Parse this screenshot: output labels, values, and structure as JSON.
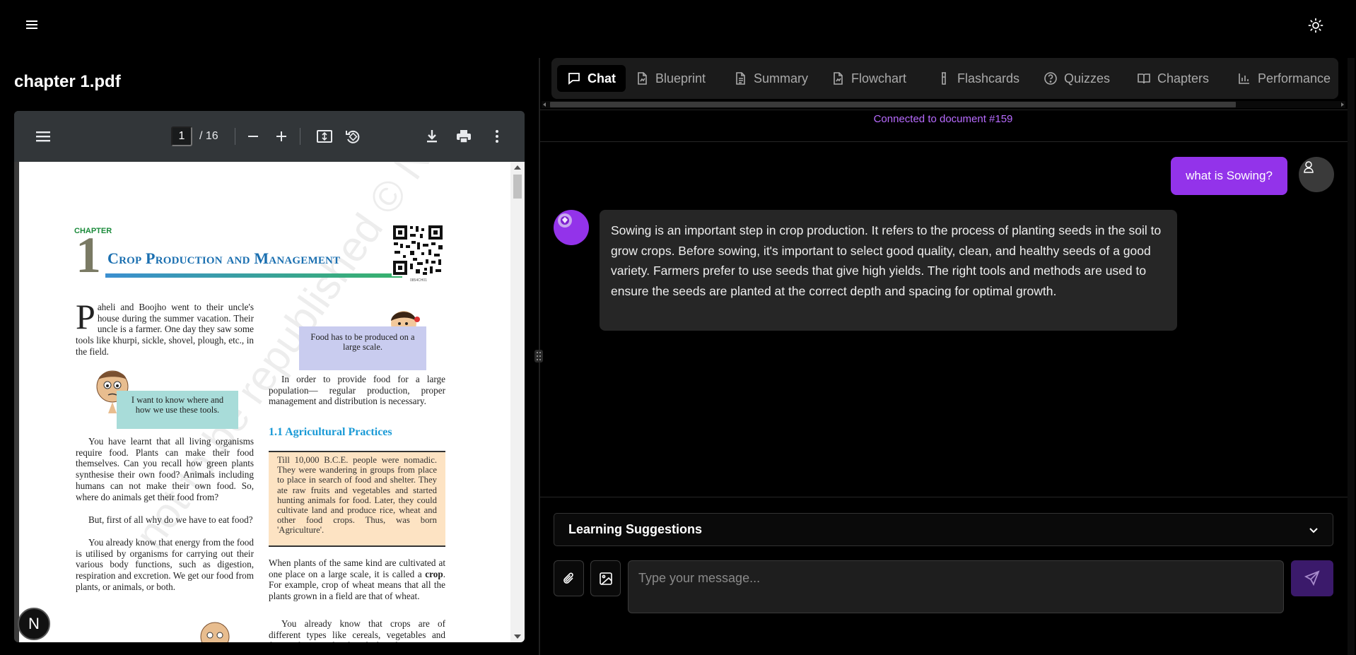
{
  "app": {
    "menu_icon": "hamburger-menu-icon",
    "theme_icon": "sun-icon"
  },
  "document": {
    "title": "chapter 1.pdf"
  },
  "viewer": {
    "page_current": "1",
    "page_total": "/ 16",
    "icons": [
      "sidebar-menu-icon",
      "zoom-out-icon",
      "zoom-in-icon",
      "fit-page-icon",
      "rotate-icon",
      "download-icon",
      "print-icon",
      "more-options-icon"
    ],
    "page": {
      "chapter_label": "CHAPTER",
      "chapter_number": "1",
      "chapter_title": "Crop Production and Management",
      "qr_code_id": "0854CH01",
      "intro_paragraph": "aheli and Boojho went to their uncle's house during the summer vacation. Their uncle is a farmer. One day they saw some tools like khurpi, sickle, shovel, plough, etc., in the field.",
      "intro_dropcap": "P",
      "callout_food": "Food has to be produced on a large scale.",
      "callout_tools": "I want to know where and how we use these tools.",
      "right_paragraph_1": "In order to provide food for a large population— regular production, proper management and distribution is necessary.",
      "section_heading": "1.1 Agricultural Practices",
      "history_box": "Till 10,000 B.C.E. people were nomadic. They were wandering in groups from place to place in search of food and shelter. They ate raw fruits and vegetables and started hunting animals for food. Later, they could cultivate land and produce rice, wheat and other food crops. Thus, was born 'Agriculture'.",
      "left_paragraph_2": "You have learnt that all living organisms require food. Plants can make their food themselves. Can you recall how green plants synthesise their own food? Animals including humans can not make their own food. So, where do animals get their food from?",
      "left_paragraph_3": "But, first of all why do we have to eat food?",
      "left_paragraph_4": "You already know that energy from the food is utilised by organisms for carrying out their various body functions, such as digestion, respiration and excretion. We get our food from plants, or animals, or both.",
      "right_paragraph_2_a": "When plants of the same kind are cultivated at one place on a large scale, it is called a ",
      "right_paragraph_2_bold": "crop",
      "right_paragraph_2_b": ". For example, crop of wheat means that all the plants grown in a field are that of wheat.",
      "right_paragraph_3": "You already know that crops are of different types like cereals, vegetables and fruits. These can be classified on the",
      "watermark": "not to be republished © NCERT"
    }
  },
  "floating_badge": "N",
  "tabs": [
    {
      "label": "Chat",
      "icon": "chat-bubble-icon",
      "active": true
    },
    {
      "label": "Blueprint",
      "icon": "document-chart-icon",
      "active": false
    },
    {
      "label": "Summary",
      "icon": "document-text-icon",
      "active": false
    },
    {
      "label": "Flowchart",
      "icon": "document-flow-icon",
      "active": false
    },
    {
      "label": "Flashcards",
      "icon": "flask-icon",
      "active": false
    },
    {
      "label": "Quizzes",
      "icon": "help-circle-icon",
      "active": false
    },
    {
      "label": "Chapters",
      "icon": "book-open-icon",
      "active": false
    },
    {
      "label": "Performance",
      "icon": "bar-chart-icon",
      "active": false
    }
  ],
  "chat": {
    "status": "Connected to document #159",
    "messages": [
      {
        "role": "user",
        "text": "what is Sowing?"
      },
      {
        "role": "assistant",
        "text": "Sowing is an important step in crop production. It refers to the process of planting seeds in the soil to grow crops. Before sowing, it's important to select good quality, clean, and healthy seeds of a good variety. Farmers prefer to use seeds that give high yields. The right tools and methods are used to ensure the seeds are planted at the correct depth and spacing for optimal growth."
      }
    ],
    "suggestions_label": "Learning Suggestions",
    "input_placeholder": "Type your message...",
    "attach_icon": "paperclip-icon",
    "image_icon": "image-icon",
    "send_icon": "send-icon"
  },
  "colors": {
    "accent": "#9333ea",
    "status_text": "#b86bff",
    "send_button": "#3b1a6b"
  }
}
